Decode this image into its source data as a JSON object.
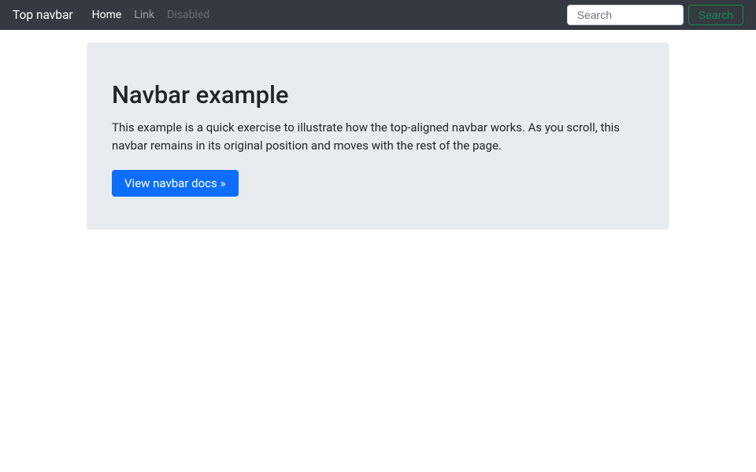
{
  "navbar": {
    "brand": "Top navbar",
    "items": [
      {
        "label": "Home",
        "state": "active"
      },
      {
        "label": "Link",
        "state": "normal"
      },
      {
        "label": "Disabled",
        "state": "disabled"
      }
    ],
    "search": {
      "placeholder": "Search",
      "value": "",
      "button_label": "Search"
    }
  },
  "main": {
    "title": "Navbar example",
    "description": "This example is a quick exercise to illustrate how the top-aligned navbar works. As you scroll, this navbar remains in its original position and moves with the rest of the page.",
    "cta_label": "View navbar docs »"
  }
}
